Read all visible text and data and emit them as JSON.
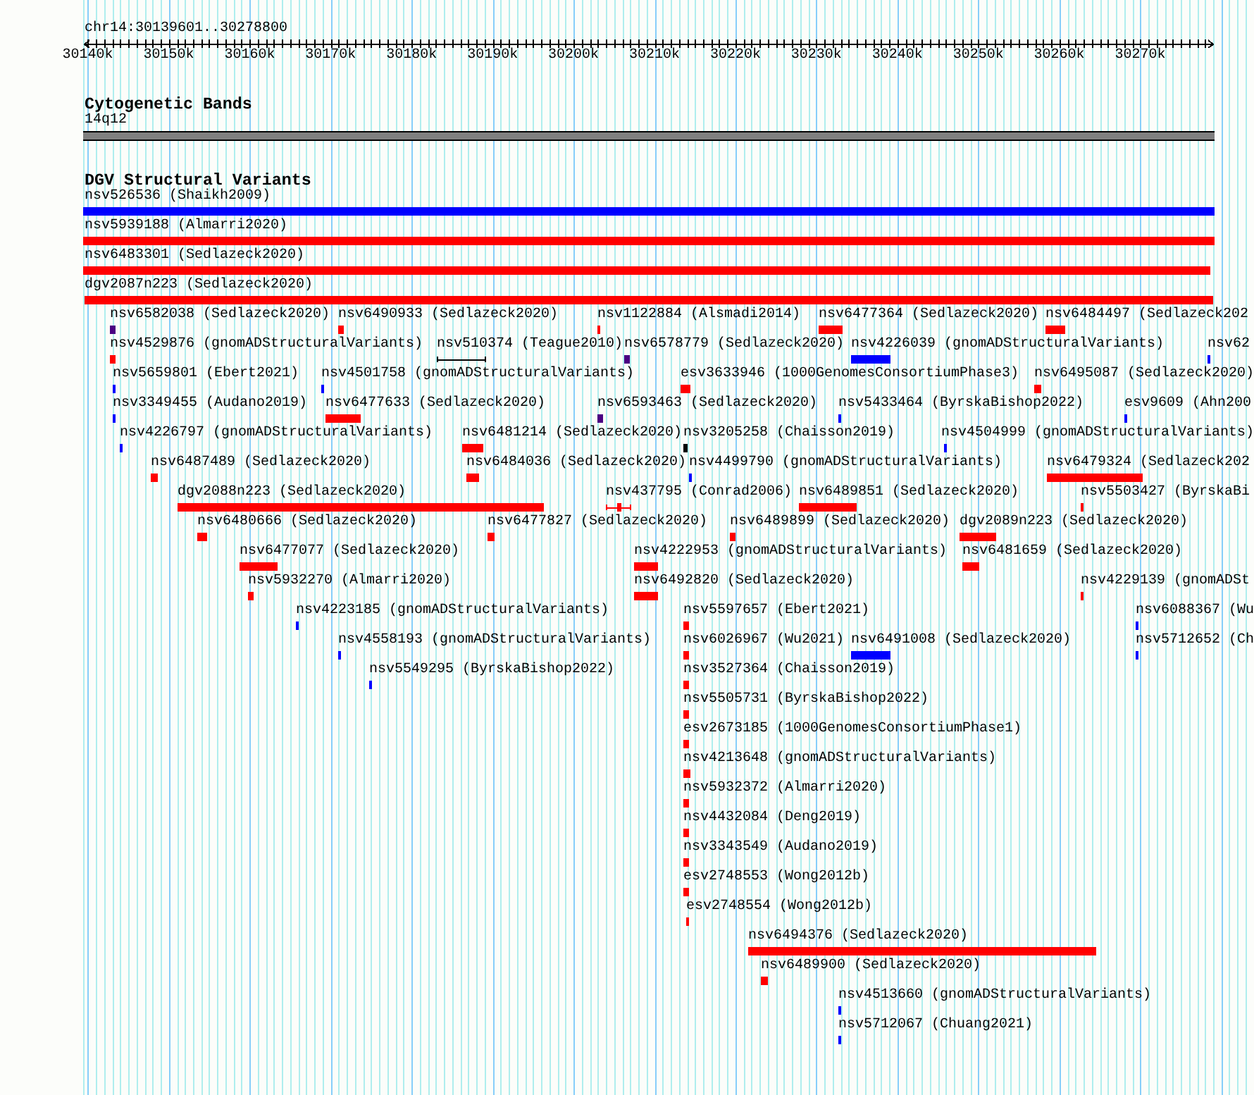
{
  "ruler": {
    "location": "chr14:30139601..30278800",
    "ticks": [
      "30140k",
      "30150k",
      "30160k",
      "30170k",
      "30180k",
      "30190k",
      "30200k",
      "30210k",
      "30220k",
      "30230k",
      "30240k",
      "30250k",
      "30260k",
      "30270k"
    ]
  },
  "cytogenetic_bands": {
    "title": "Cytogenetic Bands",
    "band_label": "14q12"
  },
  "structural_variants": {
    "title": "DGV Structural Variants",
    "rows": [
      {
        "features": [
          {
            "label": "nsv526536 (Shaikh2009)",
            "kind": "block",
            "color": "#0000ff"
          }
        ]
      },
      {
        "features": [
          {
            "label": "nsv5939188 (Almarri2020)",
            "kind": "block",
            "color": "#ff0000"
          }
        ]
      },
      {
        "features": [
          {
            "label": "nsv6483301 (Sedlazeck2020)",
            "kind": "block",
            "color": "#ff0000"
          }
        ]
      },
      {
        "features": [
          {
            "label": "dgv2087n223 (Sedlazeck2020)",
            "kind": "block",
            "color": "#ff0000"
          }
        ]
      },
      {
        "features": [
          {
            "label": "nsv6582038 (Sedlazeck2020)",
            "kind": "block",
            "color": "#4b0082"
          },
          {
            "label": "nsv6490933 (Sedlazeck2020)",
            "kind": "block",
            "color": "#ff0000"
          },
          {
            "label": "nsv1122884 (Alsmadi2014)",
            "kind": "block",
            "color": "#ff0000"
          },
          {
            "label": "nsv6477364 (Sedlazeck2020)",
            "kind": "block",
            "color": "#ff0000"
          },
          {
            "label": "nsv6484497 (Sedlazeck202",
            "kind": "block",
            "color": "#ff0000"
          }
        ]
      },
      {
        "features": [
          {
            "label": "nsv4529876 (gnomADStructuralVariants)",
            "kind": "block",
            "color": "#ff0000"
          },
          {
            "label": "nsv510374 (Teague2010)",
            "kind": "interval",
            "color": "#000000"
          },
          {
            "label": "nsv6578779 (Sedlazeck2020)",
            "kind": "block",
            "color": "#4b0082"
          },
          {
            "label": "nsv4226039 (gnomADStructuralVariants)",
            "kind": "block",
            "color": "#0000ff"
          },
          {
            "label": "nsv62",
            "kind": "block",
            "color": "#0000ff"
          }
        ]
      },
      {
        "features": [
          {
            "label": "nsv5659801 (Ebert2021)",
            "kind": "block",
            "color": "#0000ff"
          },
          {
            "label": "nsv4501758 (gnomADStructuralVariants)",
            "kind": "block",
            "color": "#0000ff"
          },
          {
            "label": "esv3633946 (1000GenomesConsortiumPhase3)",
            "kind": "block",
            "color": "#ff0000"
          },
          {
            "label": "nsv6495087 (Sedlazeck2020)",
            "kind": "block",
            "color": "#ff0000"
          }
        ]
      },
      {
        "features": [
          {
            "label": "nsv3349455 (Audano2019)",
            "kind": "block",
            "color": "#0000ff"
          },
          {
            "label": "nsv6477633 (Sedlazeck2020)",
            "kind": "block",
            "color": "#ff0000"
          },
          {
            "label": "nsv6593463 (Sedlazeck2020)",
            "kind": "block",
            "color": "#4b0082"
          },
          {
            "label": "nsv5433464 (ByrskaBishop2022)",
            "kind": "block",
            "color": "#0000ff"
          },
          {
            "label": "esv9609 (Ahn200",
            "kind": "block",
            "color": "#0000ff"
          }
        ]
      },
      {
        "features": [
          {
            "label": "nsv4226797 (gnomADStructuralVariants)",
            "kind": "block",
            "color": "#0000ff"
          },
          {
            "label": "nsv6481214 (Sedlazeck2020)",
            "kind": "block",
            "color": "#ff0000"
          },
          {
            "label": "nsv3205258 (Chaisson2019)",
            "kind": "block",
            "color": "#000000"
          },
          {
            "label": "nsv4504999 (gnomADStructuralVariants)",
            "kind": "block",
            "color": "#0000ff"
          }
        ]
      },
      {
        "features": [
          {
            "label": "nsv6487489 (Sedlazeck2020)",
            "kind": "block",
            "color": "#ff0000"
          },
          {
            "label": "nsv6484036 (Sedlazeck2020)",
            "kind": "block",
            "color": "#ff0000"
          },
          {
            "label": "nsv4499790 (gnomADStructuralVariants)",
            "kind": "block",
            "color": "#0000ff"
          },
          {
            "label": "nsv6479324 (Sedlazeck202",
            "kind": "block",
            "color": "#ff0000"
          }
        ]
      },
      {
        "features": [
          {
            "label": "dgv2088n223 (Sedlazeck2020)",
            "kind": "block",
            "color": "#ff0000"
          },
          {
            "label": "nsv437795 (Conrad2006)",
            "kind": "interval",
            "color": "#ff0000"
          },
          {
            "label": "nsv6489851 (Sedlazeck2020)",
            "kind": "block",
            "color": "#ff0000"
          },
          {
            "label": "nsv5503427 (ByrskaBi",
            "kind": "block",
            "color": "#ff0000"
          }
        ]
      },
      {
        "features": [
          {
            "label": "nsv6480666 (Sedlazeck2020)",
            "kind": "block",
            "color": "#ff0000"
          },
          {
            "label": "nsv6477827 (Sedlazeck2020)",
            "kind": "block",
            "color": "#ff0000"
          },
          {
            "label": "nsv6489899 (Sedlazeck2020)",
            "kind": "block",
            "color": "#ff0000"
          },
          {
            "label": "dgv2089n223 (Sedlazeck2020)",
            "kind": "block",
            "color": "#ff0000"
          }
        ]
      },
      {
        "features": [
          {
            "label": "nsv6477077 (Sedlazeck2020)",
            "kind": "block",
            "color": "#ff0000"
          },
          {
            "label": "nsv4222953 (gnomADStructuralVariants)",
            "kind": "block",
            "color": "#ff0000"
          },
          {
            "label": "nsv6481659 (Sedlazeck2020)",
            "kind": "block",
            "color": "#ff0000"
          }
        ]
      },
      {
        "features": [
          {
            "label": "nsv5932270 (Almarri2020)",
            "kind": "block",
            "color": "#ff0000"
          },
          {
            "label": "nsv6492820 (Sedlazeck2020)",
            "kind": "block",
            "color": "#ff0000"
          },
          {
            "label": "nsv4229139 (gnomADSt",
            "kind": "block",
            "color": "#ff0000"
          }
        ]
      },
      {
        "features": [
          {
            "label": "nsv4223185 (gnomADStructuralVariants)",
            "kind": "block",
            "color": "#0000ff"
          },
          {
            "label": "nsv5597657 (Ebert2021)",
            "kind": "block",
            "color": "#ff0000"
          },
          {
            "label": "nsv6088367 (Wu",
            "kind": "block",
            "color": "#0000ff"
          }
        ]
      },
      {
        "features": [
          {
            "label": "nsv4558193 (gnomADStructuralVariants)",
            "kind": "block",
            "color": "#0000ff"
          },
          {
            "label": "nsv6026967 (Wu2021)",
            "kind": "block",
            "color": "#ff0000"
          },
          {
            "label": "nsv6491008 (Sedlazeck2020)",
            "kind": "block",
            "color": "#0000ff"
          },
          {
            "label": "nsv5712652 (Ch",
            "kind": "block",
            "color": "#0000ff"
          }
        ]
      },
      {
        "features": [
          {
            "label": "nsv5549295 (ByrskaBishop2022)",
            "kind": "block",
            "color": "#0000ff"
          },
          {
            "label": "nsv3527364 (Chaisson2019)",
            "kind": "block",
            "color": "#ff0000"
          }
        ]
      },
      {
        "features": [
          {
            "label": "nsv5505731 (ByrskaBishop2022)",
            "kind": "block",
            "color": "#ff0000"
          }
        ]
      },
      {
        "features": [
          {
            "label": "esv2673185 (1000GenomesConsortiumPhase1)",
            "kind": "block",
            "color": "#ff0000"
          }
        ]
      },
      {
        "features": [
          {
            "label": "nsv4213648 (gnomADStructuralVariants)",
            "kind": "block",
            "color": "#ff0000"
          }
        ]
      },
      {
        "features": [
          {
            "label": "nsv5932372 (Almarri2020)",
            "kind": "block",
            "color": "#ff0000"
          }
        ]
      },
      {
        "features": [
          {
            "label": "nsv4432084 (Deng2019)",
            "kind": "block",
            "color": "#ff0000"
          }
        ]
      },
      {
        "features": [
          {
            "label": "nsv3343549 (Audano2019)",
            "kind": "block",
            "color": "#ff0000"
          }
        ]
      },
      {
        "features": [
          {
            "label": "esv2748553 (Wong2012b)",
            "kind": "block",
            "color": "#ff0000"
          }
        ]
      },
      {
        "features": [
          {
            "label": "esv2748554 (Wong2012b)",
            "kind": "block",
            "color": "#ff0000"
          }
        ]
      },
      {
        "features": [
          {
            "label": "nsv6494376 (Sedlazeck2020)",
            "kind": "block",
            "color": "#ff0000"
          }
        ]
      },
      {
        "features": [
          {
            "label": "nsv6489900 (Sedlazeck2020)",
            "kind": "block",
            "color": "#ff0000"
          }
        ]
      },
      {
        "features": [
          {
            "label": "nsv4513660 (gnomADStructuralVariants)",
            "kind": "block",
            "color": "#0000ff"
          }
        ]
      },
      {
        "features": [
          {
            "label": "nsv5712067 (Chuang2021)",
            "kind": "block",
            "color": "#0000ff"
          }
        ]
      }
    ]
  }
}
